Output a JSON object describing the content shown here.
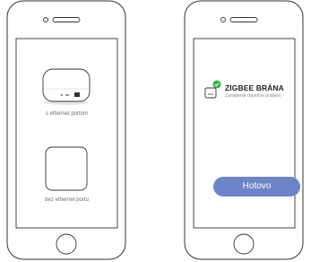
{
  "phone_left": {
    "options": [
      {
        "label": "s ethernet portom",
        "icon": "gateway-with-ethernet-icon"
      },
      {
        "label": "bez ethernet portu",
        "icon": "gateway-without-ethernet-icon"
      }
    ]
  },
  "phone_right": {
    "device": {
      "name": "ZIGBEE BRÁNA",
      "status": "Zariadenie úspešne pridané.",
      "icon": "zigbee-gateway-icon",
      "badge_icon": "check-badge-icon"
    },
    "done_label": "Hotovo"
  },
  "colors": {
    "accent": "#6e84c8",
    "success": "#2fb34a",
    "outline": "#333333"
  }
}
